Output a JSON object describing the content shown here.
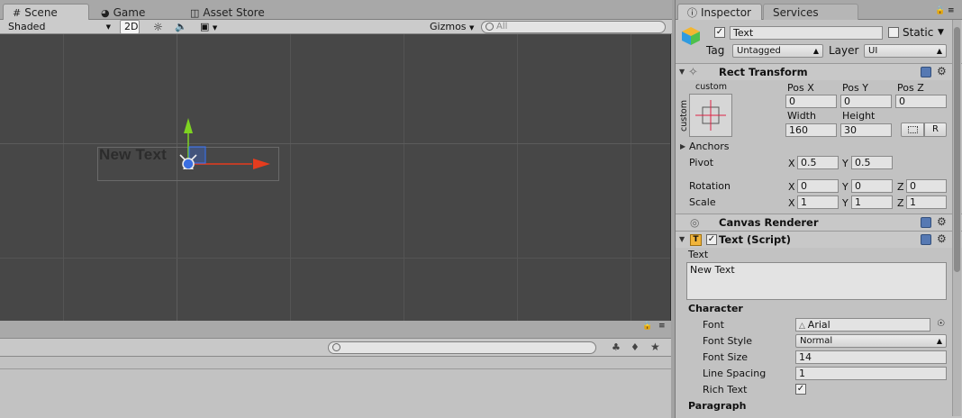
{
  "tabs": {
    "scene": "Scene",
    "game": "Game",
    "asset_store": "Asset Store",
    "inspector": "Inspector",
    "services": "Services"
  },
  "scene_toolbar": {
    "shading": "Shaded",
    "mode_2d": "2D",
    "gizmos": "Gizmos",
    "search_placeholder": "All"
  },
  "scene_view": {
    "object_text": "New Text"
  },
  "inspector": {
    "object_name": "Text",
    "static_label": "Static",
    "tag_label": "Tag",
    "tag_value": "Untagged",
    "layer_label": "Layer",
    "layer_value": "UI",
    "rect_transform": {
      "title": "Rect Transform",
      "anchor_preset_top": "custom",
      "anchor_preset_side": "custom",
      "pos_x_label": "Pos X",
      "pos_y_label": "Pos Y",
      "pos_z_label": "Pos Z",
      "pos_x": "0",
      "pos_y": "0",
      "pos_z": "0",
      "width_label": "Width",
      "height_label": "Height",
      "width": "160",
      "height": "30",
      "raw_edit_label": "R",
      "anchors_label": "Anchors",
      "pivot_label": "Pivot",
      "pivot_x": "0.5",
      "pivot_y": "0.5",
      "rotation_label": "Rotation",
      "rotation_x": "0",
      "rotation_y": "0",
      "rotation_z": "0",
      "scale_label": "Scale",
      "scale_x": "1",
      "scale_y": "1",
      "scale_z": "1",
      "axis_x": "X",
      "axis_y": "Y",
      "axis_z": "Z"
    },
    "canvas_renderer": {
      "title": "Canvas Renderer"
    },
    "text_script": {
      "title": "Text (Script)",
      "text_label": "Text",
      "text_value": "New Text",
      "character_header": "Character",
      "font_label": "Font",
      "font_value": "Arial",
      "font_style_label": "Font Style",
      "font_style_value": "Normal",
      "font_size_label": "Font Size",
      "font_size_value": "14",
      "line_spacing_label": "Line Spacing",
      "line_spacing_value": "1",
      "rich_text_label": "Rich Text",
      "paragraph_header": "Paragraph"
    }
  },
  "colors": {
    "scene_bg": "#474747",
    "inspector_bg": "#c2c2c2",
    "gizmo_y": "#7ed321",
    "gizmo_x": "#e63c1e",
    "gizmo_handle": "#3a6ee0"
  }
}
